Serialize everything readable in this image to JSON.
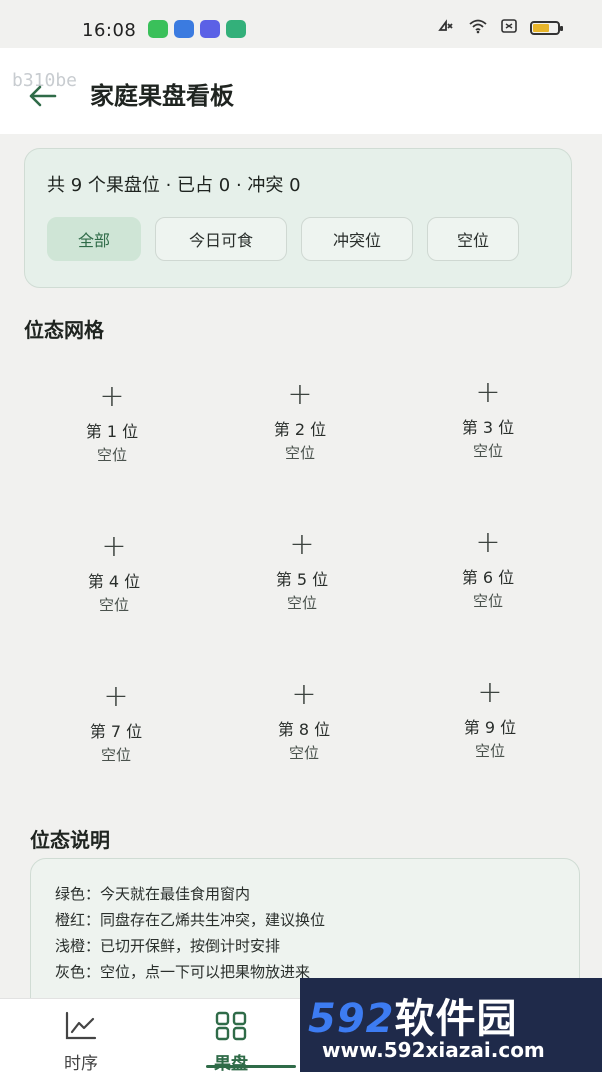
{
  "status_bar": {
    "time": "16:08",
    "app_icons": [
      {
        "name": "messages-app-icon",
        "color": "#3ac05a"
      },
      {
        "name": "browser-app-icon",
        "color": "#3b7be0"
      },
      {
        "name": "cloud-app-icon",
        "color": "#5b61e6"
      },
      {
        "name": "tips-app-icon",
        "color": "#33b07a"
      }
    ]
  },
  "app_bar": {
    "watermark": "b310be",
    "title": "家庭果盘看板"
  },
  "summary": {
    "text": "共 9 个果盘位 · 已占 0 · 冲突 0",
    "filters": [
      {
        "label": "全部",
        "active": true
      },
      {
        "label": "今日可食",
        "active": false
      },
      {
        "label": "冲突位",
        "active": false
      },
      {
        "label": "空位",
        "active": false
      }
    ]
  },
  "grid": {
    "title": "位态网格",
    "slots": [
      {
        "name": "第 1 位",
        "state": "空位"
      },
      {
        "name": "第 2 位",
        "state": "空位"
      },
      {
        "name": "第 3 位",
        "state": "空位"
      },
      {
        "name": "第 4 位",
        "state": "空位"
      },
      {
        "name": "第 5 位",
        "state": "空位"
      },
      {
        "name": "第 6 位",
        "state": "空位"
      },
      {
        "name": "第 7 位",
        "state": "空位"
      },
      {
        "name": "第 8 位",
        "state": "空位"
      },
      {
        "name": "第 9 位",
        "state": "空位"
      }
    ]
  },
  "legend": {
    "title": "位态说明",
    "lines": [
      "绿色：今天就在最佳食用窗内",
      "橙红：同盘存在乙烯共生冲突，建议换位",
      "浅橙：已切开保鲜，按倒计时安排",
      "灰色：空位，点一下可以把果物放进来"
    ]
  },
  "bottom_nav": {
    "items": [
      {
        "label": "时序",
        "icon": "trend-chart-icon",
        "active": false
      },
      {
        "label": "果盘",
        "icon": "grid-icon",
        "active": true
      }
    ]
  },
  "promo": {
    "logo_number": "592",
    "logo_text": "软件园",
    "url": "www.592xiazai.com"
  },
  "colors": {
    "accent": "#2f6b48",
    "card_bg": "#e6f0ea",
    "chip_active_bg": "#cfe5d6"
  }
}
